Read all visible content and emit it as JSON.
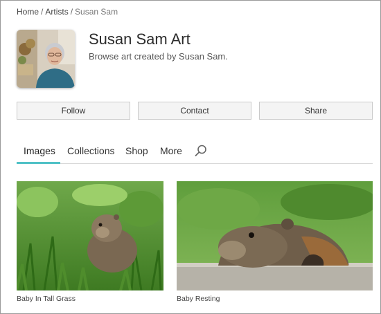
{
  "breadcrumb": {
    "items": [
      "Home",
      "Artists",
      "Susan Sam"
    ],
    "separator": "/"
  },
  "profile": {
    "name": "Susan Sam Art",
    "description": "Browse art created by Susan Sam."
  },
  "actions": {
    "follow": "Follow",
    "contact": "Contact",
    "share": "Share"
  },
  "tabs": [
    {
      "label": "Images",
      "active": true
    },
    {
      "label": "Collections",
      "active": false
    },
    {
      "label": "Shop",
      "active": false
    },
    {
      "label": "More",
      "active": false
    }
  ],
  "tabs_accent_color": "#4fc1c6",
  "search_icon": "search-icon",
  "artworks": [
    {
      "title": "Baby In Tall Grass"
    },
    {
      "title": "Baby Resting"
    }
  ]
}
